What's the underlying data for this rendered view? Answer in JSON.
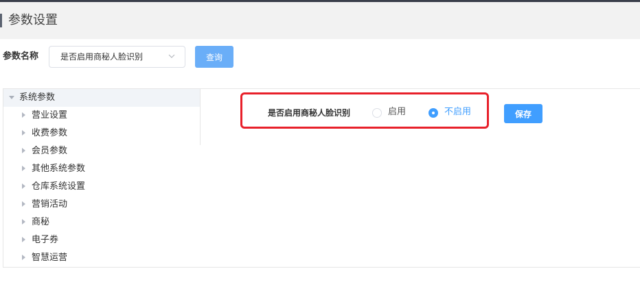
{
  "page": {
    "title": "参数设置"
  },
  "filter": {
    "label": "参数名称",
    "selected": "是否启用商秘人脸识别",
    "query_label": "查询"
  },
  "tree": {
    "root": "系统参数",
    "items": [
      "营业设置",
      "收费参数",
      "会员参数",
      "其他系统参数",
      "仓库系统设置",
      "营销活动",
      "商秘",
      "电子券",
      "智慧运营"
    ]
  },
  "setting": {
    "label": "是否启用商秘人脸识别",
    "options": [
      "启用",
      "不启用"
    ],
    "selected": "不启用",
    "save_label": "保存"
  },
  "colors": {
    "primary": "#409eff",
    "query_button": "#6aaef8",
    "highlight": "#e8202a"
  }
}
